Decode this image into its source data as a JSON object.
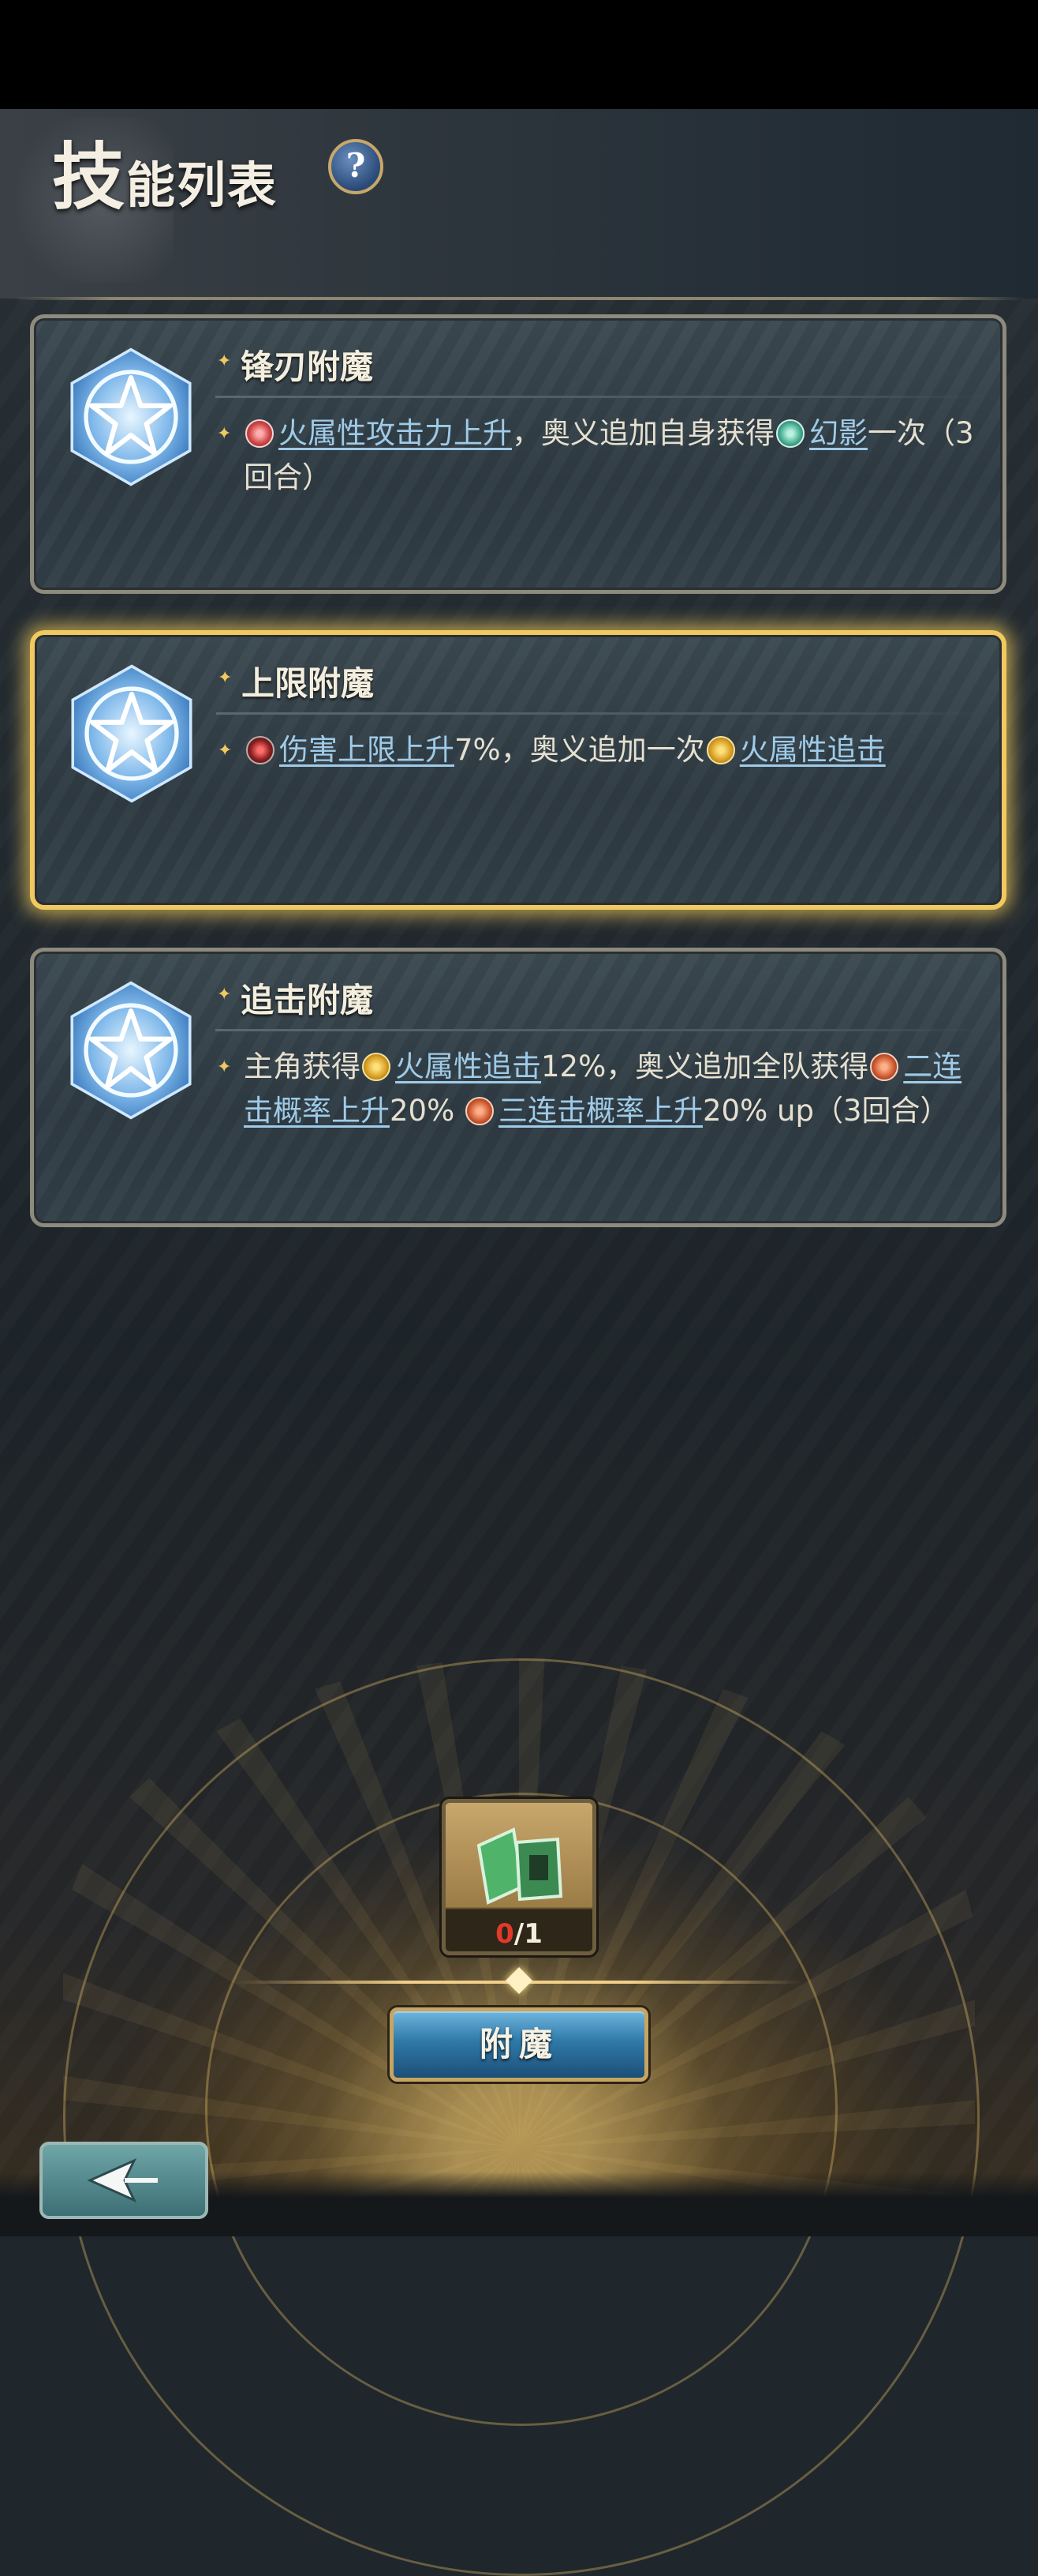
{
  "header": {
    "title_big": "技",
    "title_rest": "能列表",
    "help_label": "?"
  },
  "skills": [
    {
      "title": "锋刃附魔",
      "desc_parts": [
        "火属性攻击力上升",
        "，奥义追加自身获得",
        "幻影",
        "一次（3回合）"
      ]
    },
    {
      "title": "上限附魔",
      "desc_parts": [
        "伤害上限上升",
        "7%，奥义追加一次",
        "火属性追击"
      ]
    },
    {
      "title": "追击附魔",
      "desc_parts": [
        "主角获得",
        "火属性追击",
        "12%，奥义追加全队获得",
        "二连击概率上升",
        "20%",
        "三连击概率上升",
        "20% up（3回合）"
      ]
    }
  ],
  "material": {
    "current": "0",
    "total": "/1",
    "icon": "green-emblem-icon"
  },
  "actions": {
    "enchant_label": "附魔",
    "back_icon": "back-arrow-icon"
  },
  "colors": {
    "accent_gold": "#f0c960",
    "keyword_blue": "#9fcbe8",
    "button_blue": "#2f79a8"
  }
}
